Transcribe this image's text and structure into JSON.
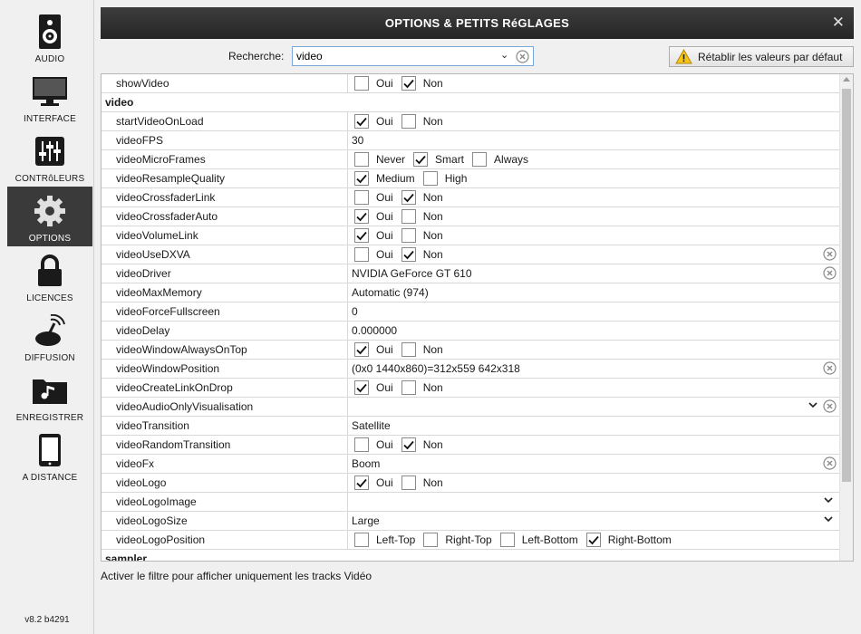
{
  "sidebar": {
    "items": [
      {
        "label": "AUDIO",
        "icon": "speaker-icon"
      },
      {
        "label": "INTERFACE",
        "icon": "monitor-icon"
      },
      {
        "label": "CONTRôLEURS",
        "icon": "sliders-icon"
      },
      {
        "label": "OPTIONS",
        "icon": "gear-icon",
        "active": true
      },
      {
        "label": "LICENCES",
        "icon": "lock-icon"
      },
      {
        "label": "DIFFUSION",
        "icon": "broadcast-icon"
      },
      {
        "label": "ENREGISTRER",
        "icon": "music-folder-icon"
      },
      {
        "label": "A DISTANCE",
        "icon": "tablet-icon"
      }
    ],
    "version": "v8.2 b4291"
  },
  "window": {
    "title": "OPTIONS & PETITS RéGLAGES",
    "close": "✕"
  },
  "search": {
    "label": "Recherche:",
    "value": "video"
  },
  "reset_button": {
    "label": "Rétablir les valeurs par défaut"
  },
  "status_text": "Activer le filtre pour afficher uniquement les tracks Vidéo",
  "rows": [
    {
      "name": "showVideo",
      "options": [
        {
          "label": "Oui",
          "checked": false
        },
        {
          "label": "Non",
          "checked": true
        }
      ]
    },
    {
      "name": "video",
      "section": true
    },
    {
      "name": "startVideoOnLoad",
      "options": [
        {
          "label": "Oui",
          "checked": true
        },
        {
          "label": "Non",
          "checked": false
        }
      ]
    },
    {
      "name": "videoFPS",
      "value": "30"
    },
    {
      "name": "videoMicroFrames",
      "options": [
        {
          "label": "Never",
          "checked": false
        },
        {
          "label": "Smart",
          "checked": true
        },
        {
          "label": "Always",
          "checked": false
        }
      ]
    },
    {
      "name": "videoResampleQuality",
      "options": [
        {
          "label": "Medium",
          "checked": true
        },
        {
          "label": "High",
          "checked": false
        }
      ]
    },
    {
      "name": "videoCrossfaderLink",
      "options": [
        {
          "label": "Oui",
          "checked": false
        },
        {
          "label": "Non",
          "checked": true
        }
      ]
    },
    {
      "name": "videoCrossfaderAuto",
      "options": [
        {
          "label": "Oui",
          "checked": true
        },
        {
          "label": "Non",
          "checked": false
        }
      ]
    },
    {
      "name": "videoVolumeLink",
      "options": [
        {
          "label": "Oui",
          "checked": true
        },
        {
          "label": "Non",
          "checked": false
        }
      ]
    },
    {
      "name": "videoUseDXVA",
      "options": [
        {
          "label": "Oui",
          "checked": false
        },
        {
          "label": "Non",
          "checked": true
        }
      ],
      "clear": true
    },
    {
      "name": "videoDriver",
      "value": "NVIDIA GeForce GT 610",
      "clear": true
    },
    {
      "name": "videoMaxMemory",
      "value": "Automatic (974)"
    },
    {
      "name": "videoForceFullscreen",
      "value": "0"
    },
    {
      "name": "videoDelay",
      "value": "0.000000"
    },
    {
      "name": "videoWindowAlwaysOnTop",
      "options": [
        {
          "label": "Oui",
          "checked": true
        },
        {
          "label": "Non",
          "checked": false
        }
      ]
    },
    {
      "name": "videoWindowPosition",
      "value": "(0x0 1440x860)=312x559 642x318",
      "clear": true
    },
    {
      "name": "videoCreateLinkOnDrop",
      "options": [
        {
          "label": "Oui",
          "checked": true
        },
        {
          "label": "Non",
          "checked": false
        }
      ]
    },
    {
      "name": "videoAudioOnlyVisualisation",
      "value": "",
      "dropdown": true,
      "clear": true
    },
    {
      "name": "videoTransition",
      "value": "Satellite"
    },
    {
      "name": "videoRandomTransition",
      "options": [
        {
          "label": "Oui",
          "checked": false
        },
        {
          "label": "Non",
          "checked": true
        }
      ]
    },
    {
      "name": "videoFx",
      "value": "Boom",
      "clear": true
    },
    {
      "name": "videoLogo",
      "options": [
        {
          "label": "Oui",
          "checked": true
        },
        {
          "label": "Non",
          "checked": false
        }
      ]
    },
    {
      "name": "videoLogoImage",
      "value": "",
      "dropdown": true
    },
    {
      "name": "videoLogoSize",
      "value": "Large",
      "dropdown": true
    },
    {
      "name": "videoLogoPosition",
      "options": [
        {
          "label": "Left-Top",
          "checked": false
        },
        {
          "label": "Right-Top",
          "checked": false
        },
        {
          "label": "Left-Bottom",
          "checked": false
        },
        {
          "label": "Right-Bottom",
          "checked": true
        }
      ]
    },
    {
      "name": "sampler",
      "section": true
    }
  ]
}
